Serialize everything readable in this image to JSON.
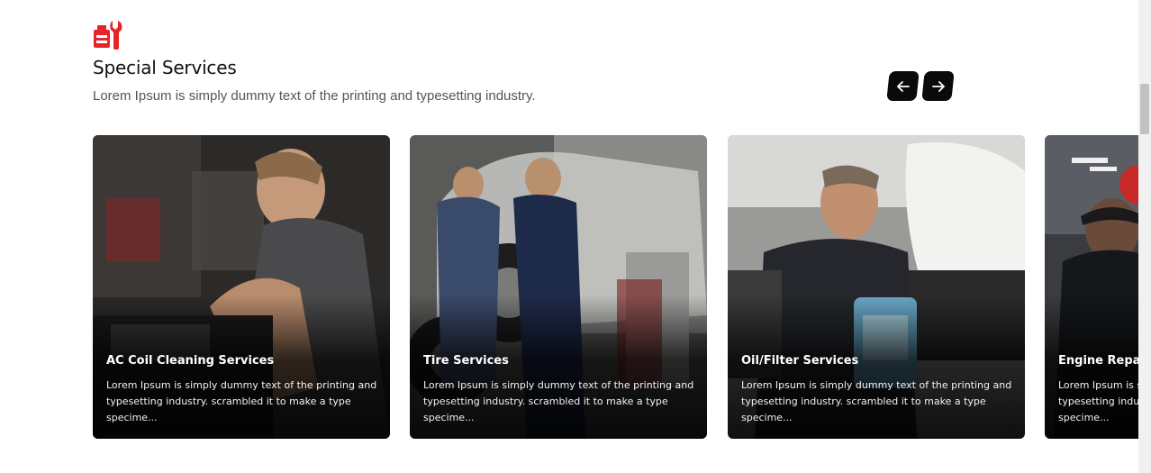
{
  "section": {
    "icon": "mechanic-wrench-icon",
    "title": "Special Services",
    "subtitle": "Lorem Ipsum is simply dummy text of the printing and typesetting industry."
  },
  "carousel": {
    "prev_icon": "arrow-left-icon",
    "next_icon": "arrow-right-icon",
    "cards": [
      {
        "title": "AC Coil Cleaning Services",
        "description": "Lorem Ipsum is simply dummy text of the printing and typesetting industry. scrambled it to make a type specime...",
        "image": "mechanic-inspecting-engine-photo"
      },
      {
        "title": "Tire Services",
        "description": "Lorem Ipsum is simply dummy text of the printing and typesetting industry. scrambled it to make a type specime...",
        "image": "mechanics-with-tires-photo"
      },
      {
        "title": "Oil/Filter Services",
        "description": "Lorem Ipsum is simply dummy text of the printing and typesetting industry. scrambled it to make a type specime...",
        "image": "mechanic-pouring-oil-photo"
      },
      {
        "title": "Engine Repair",
        "description": "Lorem Ipsum is simply dummy text of the printing and typesetting industry. scrambled it to make a type specime...",
        "image": "mechanic-engine-repair-photo"
      }
    ]
  },
  "colors": {
    "accent": "#e5252a",
    "button_bg": "#0a0a0a",
    "title": "#111111",
    "subtitle": "#555555"
  }
}
